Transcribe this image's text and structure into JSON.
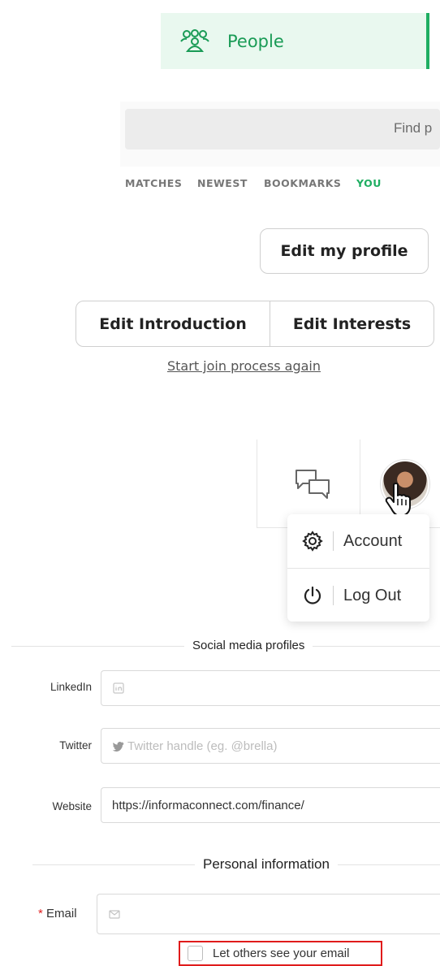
{
  "nav": {
    "people_label": "People"
  },
  "search": {
    "placeholder_visible": "Find p"
  },
  "tabs": [
    {
      "label": "MATCHES",
      "active": false
    },
    {
      "label": "NEWEST",
      "active": false
    },
    {
      "label": "BOOKMARKS",
      "active": false
    },
    {
      "label": "YOU",
      "active": true
    }
  ],
  "profile_actions": {
    "edit_profile": "Edit my profile",
    "edit_introduction": "Edit Introduction",
    "edit_interests": "Edit Interests",
    "restart_join": "Start join process again"
  },
  "user_menu": {
    "items": [
      {
        "label": "Account",
        "icon": "gear-icon"
      },
      {
        "label": "Log Out",
        "icon": "power-icon"
      }
    ]
  },
  "social": {
    "section_title": "Social media profiles",
    "linkedin_label": "LinkedIn",
    "linkedin_value": "",
    "twitter_label": "Twitter",
    "twitter_placeholder": "Twitter handle (eg. @brella)",
    "website_label": "Website",
    "website_value": "https://informaconnect.com/finance/"
  },
  "personal": {
    "section_title": "Personal information",
    "required_mark": "*",
    "email_label": "Email",
    "email_value": "",
    "show_email_label": "Let others see your email",
    "show_email_checked": false
  },
  "colors": {
    "accent_green": "#1fae62",
    "people_bg": "#e9f8ef",
    "highlight_red": "#e01b1b",
    "required_red": "#e02020"
  }
}
